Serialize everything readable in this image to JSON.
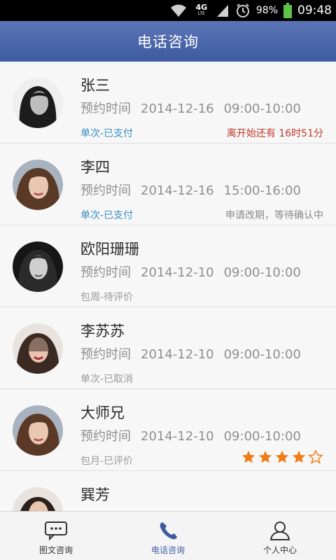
{
  "status_bar": {
    "network": "4G",
    "network_sub": "LTE",
    "battery": "98%",
    "time": "09:48",
    "icons": [
      "wifi-icon",
      "signal-icon",
      "alarm-icon",
      "battery-icon"
    ]
  },
  "header": {
    "title": "电话咨询"
  },
  "colors": {
    "header": "#4a64a8",
    "type_paid": "#3a8fc7",
    "type_other": "#9a9a9a",
    "countdown": "#c0392b",
    "status_gray": "#8a8a8a",
    "star": "#f07c16",
    "nav_active": "#3e5ba1"
  },
  "consultations": [
    {
      "name": "张三",
      "time_label": "预约时间",
      "date": "2014-12-16",
      "time": "09:00-10:00",
      "type": "单次-已支付",
      "status": "离开始还有 16时51分",
      "avatar": "avatar-photo"
    },
    {
      "name": "李四",
      "time_label": "预约时间",
      "date": "2014-12-16",
      "time": "15:00-16:00",
      "type": "单次-已支付",
      "status": "申请改期，等待确认中",
      "avatar": "avatar-photo"
    },
    {
      "name": "欧阳珊珊",
      "time_label": "预约时间",
      "date": "2014-12-10",
      "time": "09:00-10:00",
      "type": "包周-待评价",
      "status": "",
      "avatar": "avatar-photo"
    },
    {
      "name": "李苏苏",
      "time_label": "预约时间",
      "date": "2014-12-10",
      "time": "09:00-10:00",
      "type": "单次-已取消",
      "status": "",
      "avatar": "avatar-photo"
    },
    {
      "name": "大师兄",
      "time_label": "预约时间",
      "date": "2014-12-10",
      "time": "09:00-10:00",
      "type": "包月-已评价",
      "status": "",
      "rating": 4,
      "rating_max": 5,
      "avatar": "avatar-photo"
    },
    {
      "name": "巽芳",
      "time_label": "",
      "date": "",
      "time": "",
      "type": "",
      "status": "",
      "avatar": "avatar-photo"
    }
  ],
  "bottom_nav": {
    "tabs": [
      {
        "label": "图文咨询",
        "icon": "chat-icon",
        "active": false
      },
      {
        "label": "电话咨询",
        "icon": "phone-icon",
        "active": true
      },
      {
        "label": "个人中心",
        "icon": "user-icon",
        "active": false
      }
    ]
  }
}
